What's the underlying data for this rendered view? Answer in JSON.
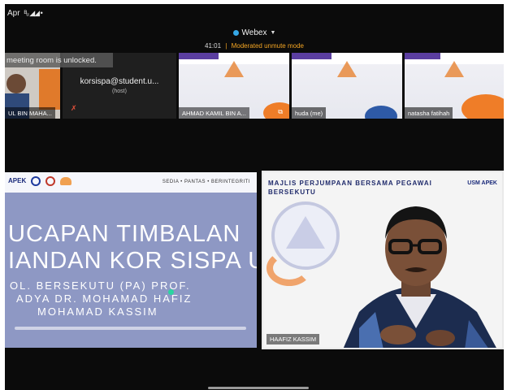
{
  "status_bar": {
    "date": "Apr",
    "icons": "ᴮᵤ ◢◢ •"
  },
  "header": {
    "app_title": "Webex",
    "timer": "41:01",
    "mode": "Moderated unmute mode"
  },
  "notification": "meeting room is unlocked.",
  "participants": [
    {
      "name": "UL BIN MAHA..."
    },
    {
      "name": "korsispa@student.u...",
      "role": "(host)"
    },
    {
      "name": "AHMAD KAMIL BIN A..."
    },
    {
      "name": "huda (me)"
    },
    {
      "name": "natasha fatihah"
    }
  ],
  "slide": {
    "logo_text": "APEK",
    "motto": "SEDIA • PANTAS • BERINTEGRITI",
    "title_line1": "UCAPAN TIMBALAN",
    "title_line2": "IANDAN KOR SISPA USM",
    "name_line1": "OL. BERSEKUTU (PA) PROF.",
    "name_line2": "ADYA DR. MOHAMAD HAFIZ",
    "name_line3": "MOHAMAD KASSIM"
  },
  "speaker": {
    "slide_header": "MAJLIS PERJUMPAAN BERSAMA PEGAWAI BERSEKUTU",
    "logos": "USM APEK",
    "name": "HAAFIZ KASSIM"
  },
  "colors": {
    "accent_orange": "#f5a623",
    "webex_blue": "#35a7e6",
    "slide_blue": "#8e98c4"
  }
}
